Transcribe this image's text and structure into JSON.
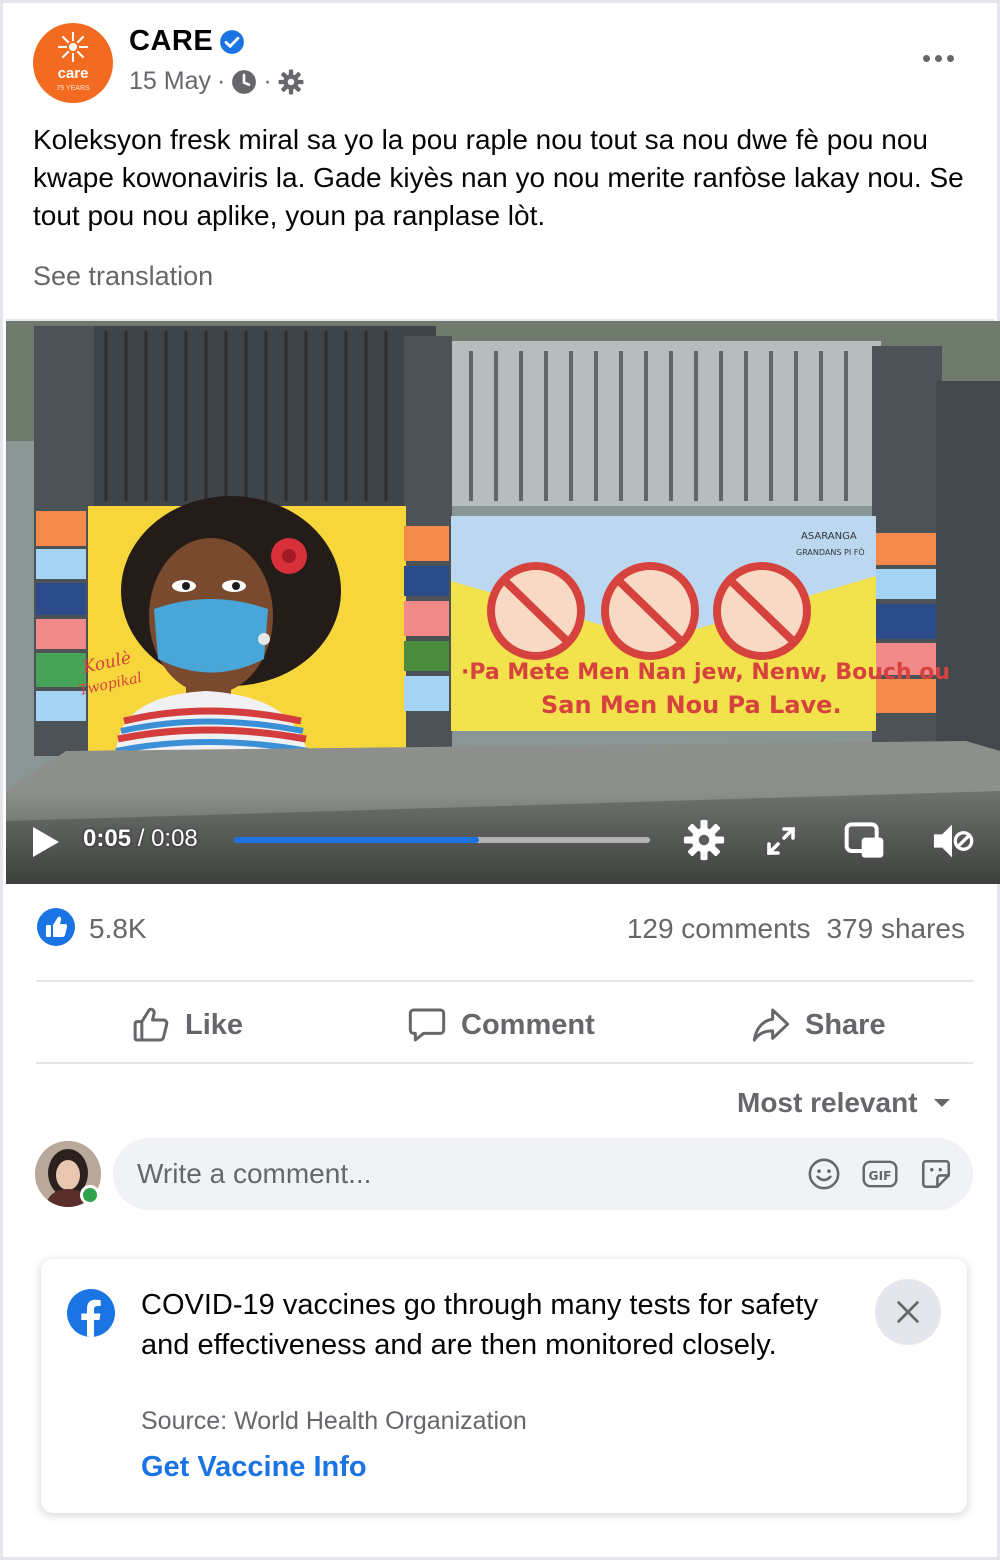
{
  "post": {
    "page_name": "CARE",
    "verified_icon": "verified-badge-icon",
    "date": "15 May",
    "separator": "·",
    "audience_icon": "globe-clock-icon",
    "settings_icon": "gear-icon",
    "text": "Koleksyon fresk miral sa yo la pou raple nou tout sa nou dwe fè  pou nou kwape kowonaviris la. Gade kiyès nan yo nou merite ranfòse lakay nou. Se tout pou nou aplike, youn pa ranplase lòt.",
    "see_translation": "See translation",
    "avatar_logo": {
      "name": "care",
      "sub": "75 YEARS"
    }
  },
  "video": {
    "current_time": "0:05",
    "separator": " / ",
    "duration": "0:08",
    "progress_fraction": 0.59,
    "mural": {
      "signature_line1": "Koulè",
      "signature_line2": "Twopikal",
      "slogan_line1": "·Pa Mete Men Nan jew, Nenw, Bouch ou",
      "slogan_line2": "San Men Nou Pa Lave.",
      "sponsor": "ASARANGA",
      "sponsor_sub": "GRANDANS PI FÒ"
    }
  },
  "stats": {
    "reactions": "5.8K",
    "comments": "129 comments",
    "shares": "379 shares"
  },
  "actions": {
    "like": "Like",
    "comment": "Comment",
    "share": "Share"
  },
  "sort": {
    "label": "Most relevant"
  },
  "composer": {
    "placeholder": "Write a comment..."
  },
  "info_card": {
    "text": "COVID-19 vaccines go through many tests for safety and effectiveness and are then monitored closely.",
    "source": "Source: World Health Organization",
    "link": "Get Vaccine Info"
  },
  "colors": {
    "accent": "#1b74e4",
    "care_orange": "#f26b21",
    "secondary_text": "#65676b"
  }
}
